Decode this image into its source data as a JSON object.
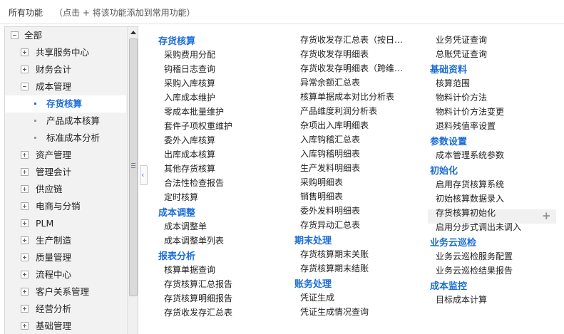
{
  "header": {
    "title": "所有功能",
    "hint": "（点击 + 将该功能添加到常用功能）"
  },
  "sidebar": {
    "items": [
      {
        "label": "全部",
        "level": 0,
        "state": "expanded"
      },
      {
        "label": "共享服务中心",
        "level": 1,
        "state": "collapsed"
      },
      {
        "label": "财务会计",
        "level": 1,
        "state": "collapsed"
      },
      {
        "label": "成本管理",
        "level": 1,
        "state": "expanded"
      },
      {
        "label": "存货核算",
        "level": 2,
        "state": "active"
      },
      {
        "label": "产品成本核算",
        "level": 2,
        "state": "leaf"
      },
      {
        "label": "标准成本分析",
        "level": 2,
        "state": "leaf"
      },
      {
        "label": "资产管理",
        "level": 1,
        "state": "collapsed"
      },
      {
        "label": "管理会计",
        "level": 1,
        "state": "collapsed"
      },
      {
        "label": "供应链",
        "level": 1,
        "state": "collapsed"
      },
      {
        "label": "电商与分销",
        "level": 1,
        "state": "collapsed"
      },
      {
        "label": "PLM",
        "level": 1,
        "state": "collapsed"
      },
      {
        "label": "生产制造",
        "level": 1,
        "state": "collapsed"
      },
      {
        "label": "质量管理",
        "level": 1,
        "state": "collapsed"
      },
      {
        "label": "流程中心",
        "level": 1,
        "state": "collapsed"
      },
      {
        "label": "客户关系管理",
        "level": 1,
        "state": "collapsed"
      },
      {
        "label": "经营分析",
        "level": 1,
        "state": "collapsed"
      },
      {
        "label": "基础管理",
        "level": 1,
        "state": "collapsed"
      }
    ]
  },
  "collapse_button": "‹",
  "add_button": "+",
  "columns": [
    [
      {
        "title": "存货核算",
        "items": [
          "采购费用分配",
          "钩稽日志查询",
          "采购入库核算",
          "入库成本维护",
          "零成本批量维护",
          "套件子项权重维护",
          "委外入库核算",
          "出库成本核算",
          "其他存货核算",
          "合法性检查报告",
          "定时核算"
        ]
      },
      {
        "title": "成本调整",
        "items": [
          "成本调整单",
          "成本调整单列表"
        ]
      },
      {
        "title": "报表分析",
        "items": [
          "核算单据查询",
          "存货核算汇总报告",
          "存货核算明细报告",
          "存货收发存汇总表"
        ]
      }
    ],
    [
      {
        "title": "",
        "items": [
          "存货收发存汇总表（按日…",
          "存货收发存明细表",
          "存货收发存明细表（跨维…",
          "异常余额汇总表",
          "核算单据成本对比分析表",
          "产品维度利润分析表",
          "杂项出入库明细表",
          "入库钩稽汇总表",
          "入库钩稽明细表",
          "生产发料明细表",
          "采购明细表",
          "销售明细表",
          "委外发料明细表",
          "存货异动汇总表"
        ]
      },
      {
        "title": "期末处理",
        "items": [
          "存货核算期末关账",
          "存货核算期末结账"
        ]
      },
      {
        "title": "账务处理",
        "items": [
          "凭证生成",
          "凭证生成情况查询"
        ]
      }
    ],
    [
      {
        "title": "",
        "items": [
          "业务凭证查询",
          "总账凭证查询"
        ]
      },
      {
        "title": "基础资料",
        "items": [
          "核算范围",
          "物料计价方法",
          "物料计价方法变更",
          "退料残值率设置"
        ]
      },
      {
        "title": "参数设置",
        "items": [
          "成本管理系统参数"
        ]
      },
      {
        "title": "初始化",
        "items": [
          "启用存货核算系统",
          "初始核算数据录入",
          "存货核算初始化",
          "启用分步式调出未调入"
        ]
      },
      {
        "title": "业务云巡检",
        "items": [
          "业务云巡检服务配置",
          "业务云巡检结果报告"
        ]
      },
      {
        "title": "成本监控",
        "items": [
          "目标成本计算"
        ]
      }
    ]
  ]
}
